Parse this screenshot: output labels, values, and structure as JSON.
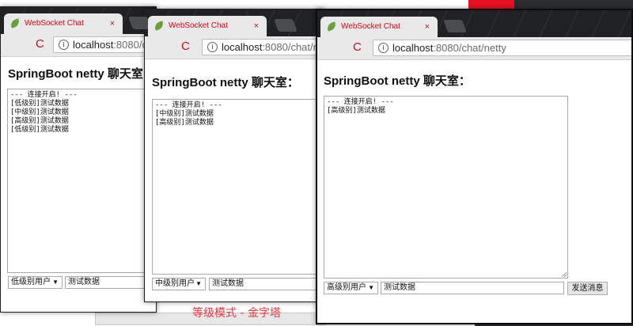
{
  "page_title": "SpringBoot netty 聊天室：",
  "browser": {
    "tab_title": "WebSocket Chat",
    "tab_close": "×",
    "url_host": "localhost",
    "url_path": ":8080/chat/netty",
    "url_path_cut_left": ":8080/chat/",
    "url_path_cut_middle": ":8080/chat/nett",
    "info_glyph": "i",
    "reload_glyph": "C"
  },
  "windows": [
    {
      "name": "low",
      "heading": "SpringBoot netty 聊天室",
      "log": "--- 连接开启! ---\n[低级别]测试数据\n[中级别]测试数据\n[高级别]测试数据\n[低级别]测试数据",
      "select_value": "低级别用户",
      "input_value": "测试数据"
    },
    {
      "name": "mid",
      "heading": "SpringBoot netty 聊天室：",
      "log": "--- 连接开启! ---\n[中级别]测试数据\n[高级别]测试数据",
      "select_value": "中级别用户",
      "input_value": "测试数据"
    },
    {
      "name": "high",
      "heading": "SpringBoot netty 聊天室：",
      "log": "--- 连接开启! ---\n[高级别]测试数据",
      "select_value": "高级别用户",
      "input_value": "测试数据",
      "send_label": "发送消息"
    }
  ],
  "select_arrow": "▼",
  "caption": "等级模式 - 金字塔"
}
